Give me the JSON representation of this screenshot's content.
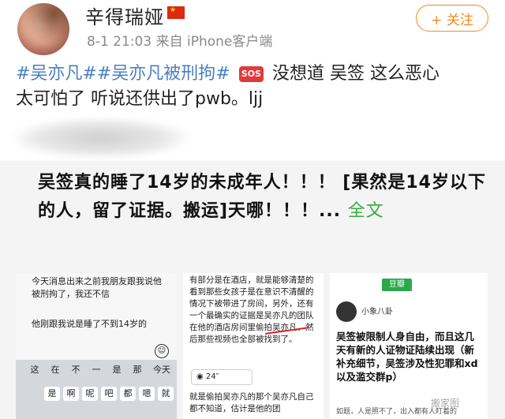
{
  "post": {
    "username": "辛得瑞娅",
    "meta": "8-1 21:03  来自 iPhone客户端",
    "follow_label": "+ 关注",
    "text_tags": "#吴亦凡##吴亦凡被刑拘#",
    "sos": "SOS",
    "text_line1_rest": "没想道 吴签 这么恶心",
    "text_line2": "太可怕了 听说还供出了pwb。ljj"
  },
  "repost": {
    "text": "吴签真的睡了14岁的未成年人！！！ [果然是14岁以下的人，留了证据。搬运]天哪！！！... ",
    "full_link": "全文"
  },
  "images": {
    "img1": {
      "line1": "今天消息出来之前我朋友跟我说他",
      "line2": "被刑拘了，我还不信",
      "line3": "他刚跟我说是睡了不到14岁的",
      "keys_row1": [
        "这",
        "在",
        "不",
        "一",
        "是",
        "那",
        "今天"
      ],
      "keys_row2": [
        "是",
        "啊",
        "呢",
        "吧",
        "都",
        "嗯",
        "就"
      ]
    },
    "img2": {
      "text1": "有部分是在酒店，就是能够清楚的看到那些女孩子是在意识不清醒的情况下被带进了房间，另外，还有一个最确实的证据是吴亦凡的团队在他的酒店房间里偷拍吴亦凡，然后那些视频也全部被找到了。",
      "voice": "24″",
      "text2": "就是偷拍吴亦凡的那个吴亦凡自己都不知道，估计是他的团"
    },
    "img3": {
      "logo": "豆瓣",
      "group": "小象八卦",
      "text": "吴签被限制人身自由，而且这几天有新的人证物证陆续出现（新补充细节，吴签涉及性犯罪和xd以及滥交群p）",
      "footer": "如题，人是照不了，出入都有人盯着的",
      "watermark": "搬家图"
    }
  }
}
